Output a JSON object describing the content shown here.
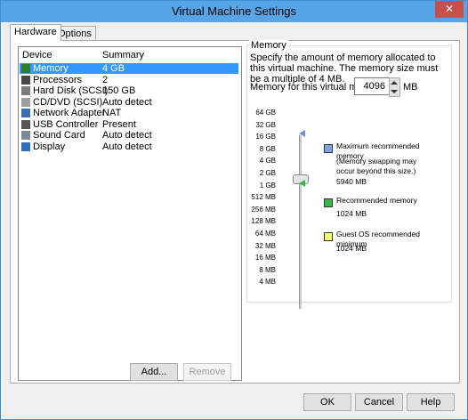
{
  "window": {
    "title": "Virtual Machine Settings",
    "close_glyph": "✕"
  },
  "tabs": [
    {
      "label": "Hardware"
    },
    {
      "label": "Options"
    }
  ],
  "device_table": {
    "headers": {
      "device": "Device",
      "summary": "Summary"
    },
    "rows": [
      {
        "device": "Memory",
        "summary": "4 GB",
        "icon": "memory-icon",
        "selected": true
      },
      {
        "device": "Processors",
        "summary": "2",
        "icon": "processor-icon"
      },
      {
        "device": "Hard Disk (SCSI)",
        "summary": "150 GB",
        "icon": "hard-disk-icon"
      },
      {
        "device": "CD/DVD (SCSI)",
        "summary": "Auto detect",
        "icon": "cd-dvd-icon"
      },
      {
        "device": "Network Adapter",
        "summary": "NAT",
        "icon": "network-adapter-icon"
      },
      {
        "device": "USB Controller",
        "summary": "Present",
        "icon": "usb-controller-icon"
      },
      {
        "device": "Sound Card",
        "summary": "Auto detect",
        "icon": "sound-card-icon"
      },
      {
        "device": "Display",
        "summary": "Auto detect",
        "icon": "display-icon"
      }
    ]
  },
  "buttons": {
    "add": "Add...",
    "remove": "Remove",
    "ok": "OK",
    "cancel": "Cancel",
    "help": "Help"
  },
  "memory": {
    "group_title": "Memory",
    "description": "Specify the amount of memory allocated to this virtual machine. The memory size must be a multiple of 4 MB.",
    "field_label": "Memory for this virtual machine:",
    "value": "4096",
    "unit": "MB",
    "scale_labels": [
      "64 GB",
      "32 GB",
      "16 GB",
      "8 GB",
      "4 GB",
      "2 GB",
      "1 GB",
      "512 MB",
      "256 MB",
      "128 MB",
      "64 MB",
      "32 MB",
      "16 MB",
      "8 MB",
      "4 MB"
    ],
    "legend": {
      "max_title": "Maximum recommended memory",
      "max_note": "(Memory swapping may occur beyond this size.)",
      "max_value": "5940 MB",
      "rec_title": "Recommended memory",
      "rec_value": "1024 MB",
      "guest_title": "Guest OS recommended minimum",
      "guest_value": "1024 MB"
    },
    "colors": {
      "max": "#7aa7d8",
      "recommended": "#3fb34f",
      "guest": "#ffff66"
    }
  }
}
